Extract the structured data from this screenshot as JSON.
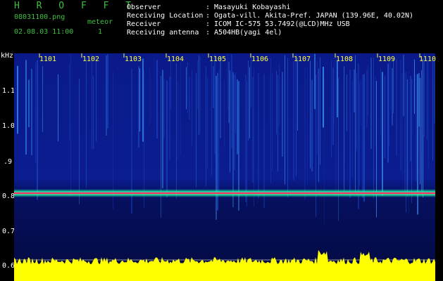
{
  "header": {
    "brand": "H R O F F T",
    "filename": "08031100.png",
    "meteor_label": "meteor",
    "datetime": "02.08.03 11:00",
    "meteor_count": "1",
    "fields": [
      {
        "label": "Observer",
        "value": ": Masayuki Kobayashi"
      },
      {
        "label": "Receiving Location",
        "value": ": Ogata-vill. Akita-Pref. JAPAN (139.96E, 40.02N)"
      },
      {
        "label": "Receiver",
        "value": ": ICOM IC-575 53.7492(@LCD)MHz USB"
      },
      {
        "label": "Receiving antenna",
        "value": ": A504HB(yagi 4el)"
      }
    ]
  },
  "axis": {
    "unit": "kHz",
    "ticks": [
      "1.1",
      "1.0",
      ".9",
      "0.8",
      "0.7",
      "0.6"
    ]
  },
  "minutes": [
    "1101",
    "1102",
    "1103",
    "1104",
    "1105",
    "1106",
    "1107",
    "1108",
    "1109",
    "1110"
  ],
  "colors": {
    "background": "#000000",
    "header_green": "#3fbf3f",
    "header_white": "#ffffff",
    "minute_label": "#ffff40",
    "spectrogram_blue": "#0a1a7a",
    "carrier_line": "#ff3060",
    "level_trace": "#ffff00"
  }
}
